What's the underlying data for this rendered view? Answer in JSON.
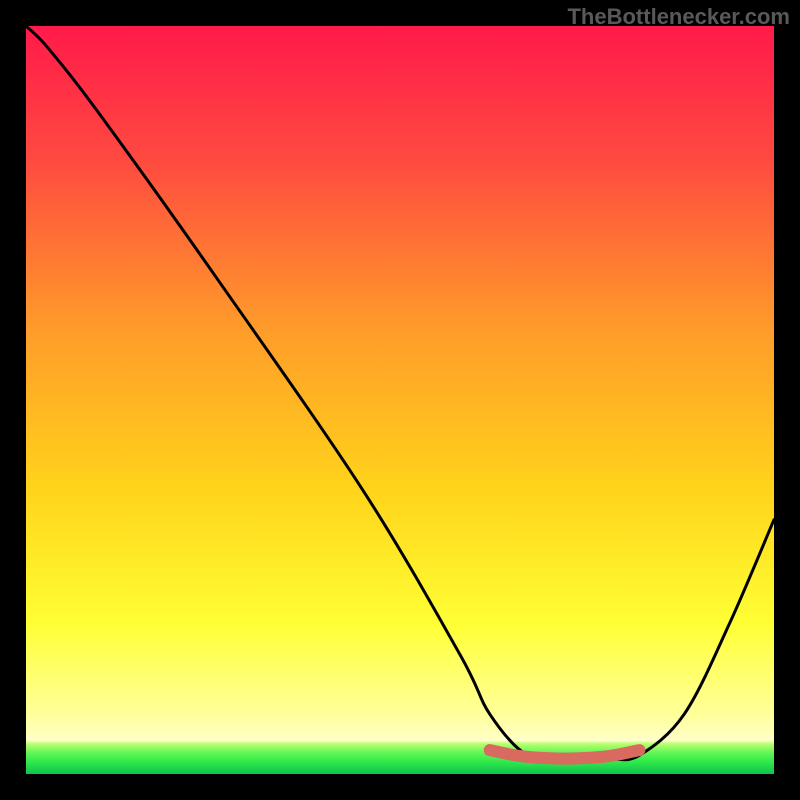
{
  "attribution": "TheBottlenecker.com",
  "colors": {
    "top": "#ff1a4a",
    "mid_upper": "#ff7a3a",
    "mid": "#ffd41a",
    "mid_lower": "#ffff35",
    "low_pale": "#ffffa0",
    "green_light": "#7dff55",
    "green_mid": "#2fe84a",
    "green_deep": "#0fc24f",
    "curve": "#000000",
    "blob": "#d86a60"
  },
  "chart_data": {
    "type": "line",
    "title": "",
    "xlabel": "",
    "ylabel": "",
    "xlim": [
      0,
      100
    ],
    "ylim": [
      0,
      100
    ],
    "series": [
      {
        "name": "bottleneck-curve",
        "x": [
          0,
          3,
          10,
          25,
          45,
          58,
          62,
          67,
          72,
          78,
          82,
          88,
          94,
          100
        ],
        "y": [
          100,
          97,
          88,
          67,
          38,
          16,
          8,
          2.5,
          2,
          2,
          2.5,
          8,
          20,
          34
        ]
      },
      {
        "name": "sweet-spot-blob",
        "x": [
          62,
          66,
          70,
          74,
          78,
          82
        ],
        "y": [
          3.2,
          2.4,
          2.1,
          2.1,
          2.4,
          3.2
        ]
      }
    ],
    "annotations": []
  }
}
